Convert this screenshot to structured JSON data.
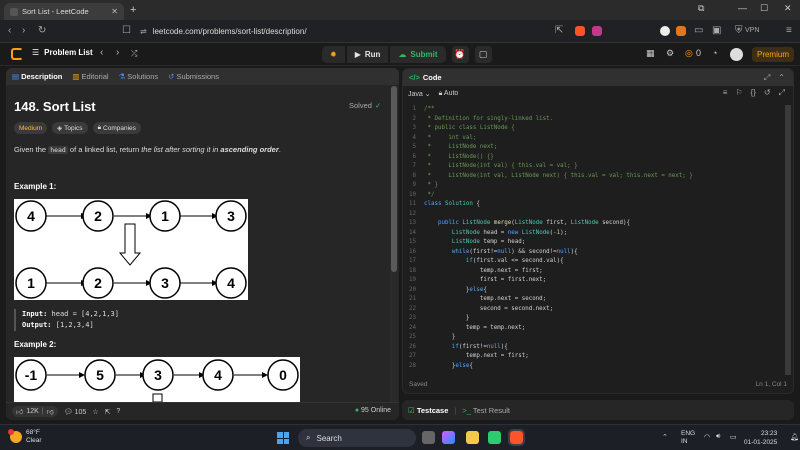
{
  "browser": {
    "tab_title": "Sort List - LeetCode",
    "url": "leetcode.com/problems/sort-list/description/",
    "vpn_label": "VPN"
  },
  "nav": {
    "problem_list": "Problem List",
    "run": "Run",
    "submit": "Submit",
    "coins": "0",
    "premium": "Premium"
  },
  "left": {
    "tabs": [
      "Description",
      "Editorial",
      "Solutions",
      "Submissions"
    ],
    "title": "148. Sort List",
    "solved": "Solved",
    "chips": [
      "Medium",
      "Topics",
      "Companies"
    ],
    "desc": {
      "p1": "Given the ",
      "code": "head",
      "p2": " of a linked list, return ",
      "p3": "the list after sorting it in ",
      "p4": "ascending order",
      "p5": "."
    },
    "example1": {
      "heading": "Example 1:",
      "top_nodes": [
        "4",
        "2",
        "1",
        "3"
      ],
      "bottom_nodes": [
        "1",
        "2",
        "3",
        "4"
      ],
      "input_label": "Input:",
      "input_value": " head = [4,2,1,3]",
      "output_label": "Output:",
      "output_value": " [1,2,3,4]"
    },
    "example2": {
      "heading": "Example 2:",
      "top_nodes": [
        "-1",
        "5",
        "3",
        "4",
        "0"
      ]
    },
    "footer": {
      "likes": "12K",
      "comments": "105",
      "online": "95 Online"
    }
  },
  "right": {
    "tab": "Code",
    "language": "Java",
    "mode": "Auto",
    "status": "Saved",
    "position": "Ln 1, Col 1",
    "code_lines": [
      [
        [
          "c-cm",
          "/**"
        ]
      ],
      [
        [
          "c-cm",
          " * Definition for singly-linked list."
        ]
      ],
      [
        [
          "c-cm",
          " * public class ListNode {"
        ]
      ],
      [
        [
          "c-cm",
          " *     int val;"
        ]
      ],
      [
        [
          "c-cm",
          " *     ListNode next;"
        ]
      ],
      [
        [
          "c-cm",
          " *     ListNode() {}"
        ]
      ],
      [
        [
          "c-cm",
          " *     ListNode(int val) { this.val = val; }"
        ]
      ],
      [
        [
          "c-cm",
          " *     ListNode(int val, ListNode next) { this.val = val; this.next = next; }"
        ]
      ],
      [
        [
          "c-cm",
          " * }"
        ]
      ],
      [
        [
          "c-cm",
          " */"
        ]
      ],
      [
        [
          "c-kw",
          "class "
        ],
        [
          "c-ty",
          "Solution"
        ],
        [
          "src",
          " {"
        ]
      ],
      [
        [
          "src",
          ""
        ]
      ],
      [
        [
          "src",
          "    "
        ],
        [
          "c-kw",
          "public "
        ],
        [
          "c-ty",
          "ListNode "
        ],
        [
          "c-fn",
          "merge"
        ],
        [
          "src",
          "("
        ],
        [
          "c-ty",
          "ListNode "
        ],
        [
          "src",
          "first, "
        ],
        [
          "c-ty",
          "ListNode "
        ],
        [
          "src",
          "second){"
        ]
      ],
      [
        [
          "src",
          "        "
        ],
        [
          "c-ty",
          "ListNode "
        ],
        [
          "src",
          "head = "
        ],
        [
          "c-kw",
          "new "
        ],
        [
          "c-ty",
          "ListNode"
        ],
        [
          "src",
          "("
        ],
        [
          "c-nu",
          "-1"
        ],
        [
          "src",
          ");"
        ]
      ],
      [
        [
          "src",
          "        "
        ],
        [
          "c-ty",
          "ListNode "
        ],
        [
          "src",
          "temp = head;"
        ]
      ],
      [
        [
          "src",
          "        "
        ],
        [
          "c-kw",
          "while"
        ],
        [
          "src",
          "(first!="
        ],
        [
          "c-kw",
          "null"
        ],
        [
          "src",
          ") && second!="
        ],
        [
          "c-kw",
          "null"
        ],
        [
          "src",
          "){"
        ]
      ],
      [
        [
          "src",
          "            "
        ],
        [
          "c-kw",
          "if"
        ],
        [
          "src",
          "(first.val <= second.val){"
        ]
      ],
      [
        [
          "src",
          "                temp.next = first;"
        ]
      ],
      [
        [
          "src",
          "                first = first.next;"
        ]
      ],
      [
        [
          "src",
          "            }"
        ],
        [
          "c-kw",
          "else"
        ],
        [
          "src",
          "{"
        ]
      ],
      [
        [
          "src",
          "                temp.next = second;"
        ]
      ],
      [
        [
          "src",
          "                second = second.next;"
        ]
      ],
      [
        [
          "src",
          "            }"
        ]
      ],
      [
        [
          "src",
          "            temp = temp.next;"
        ]
      ],
      [
        [
          "src",
          "        }"
        ]
      ],
      [
        [
          "src",
          "        "
        ],
        [
          "c-kw",
          "if"
        ],
        [
          "src",
          "(first!="
        ],
        [
          "c-kw",
          "null"
        ],
        [
          "src",
          "){"
        ]
      ],
      [
        [
          "src",
          "            temp.next = first;"
        ]
      ],
      [
        [
          "src",
          "        }"
        ],
        [
          "c-kw",
          "else"
        ],
        [
          "src",
          "{"
        ]
      ]
    ]
  },
  "bottom": {
    "testcase": "Testcase",
    "result": "Test Result"
  },
  "taskbar": {
    "temp": "68°F",
    "weather": "Clear",
    "search": "Search",
    "lang1": "ENG",
    "lang2": "IN",
    "time": "23:23",
    "date": "01-01-2025"
  },
  "colors": {
    "accent_orange": "#ffa116",
    "green": "#2cbb5d",
    "blue": "#4c8cff"
  }
}
